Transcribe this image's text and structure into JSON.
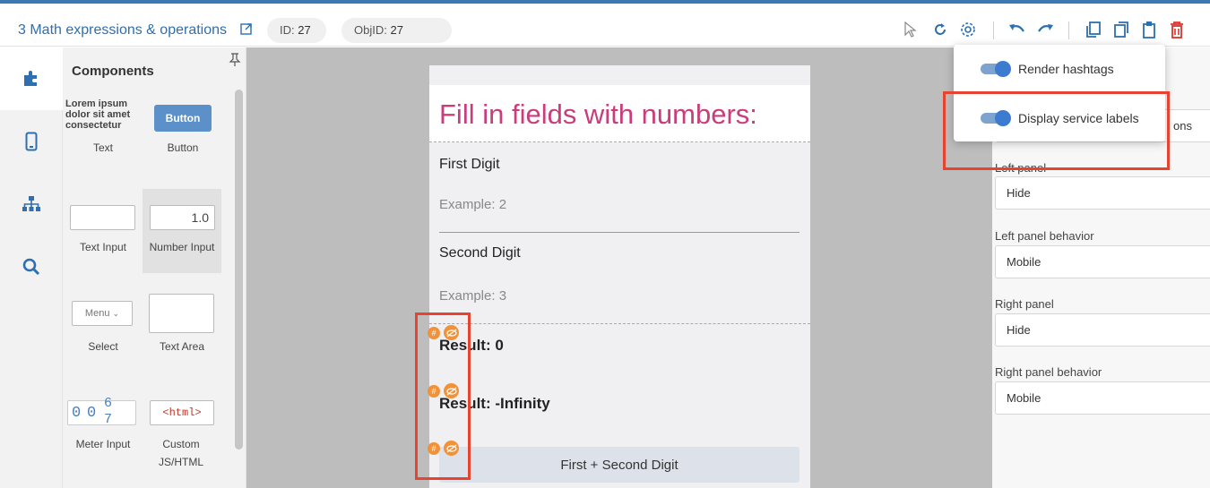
{
  "header": {
    "title": "3 Math expressions & operations",
    "id_label": "ID:",
    "id_value": "27",
    "objid_label": "ObjID:",
    "objid_value": "27"
  },
  "components": {
    "title": "Components",
    "lorem": "Lorem ipsum dolor sit amet consectetur",
    "button_preview": "Button",
    "number_preview": "1.0",
    "menu_preview": "Menu",
    "meter_digits": [
      "0",
      "0",
      "6",
      "7"
    ],
    "html_preview": "<html>",
    "items": [
      "Text",
      "Button",
      "Text Input",
      "Number Input",
      "Select",
      "Text Area",
      "Meter Input",
      "Custom JS/HTML"
    ]
  },
  "screen": {
    "heading": "Fill in fields with numbers:",
    "first_label": "First Digit",
    "first_placeholder": "Example: 2",
    "second_label": "Second Digit",
    "second_placeholder": "Example: 3",
    "result1": "Result: 0",
    "result2": "Result: -Infinity",
    "sum_button": "First + Second Digit",
    "hash_badge": "#"
  },
  "popup": {
    "render_hashtags": "Render hashtags",
    "display_service_labels": "Display service labels"
  },
  "right_panel": {
    "partial_text": "ons",
    "left_panel_label": "Left panel",
    "left_panel_value": "Hide",
    "left_panel_behavior_label": "Left panel behavior",
    "left_panel_behavior_value": "Mobile",
    "right_panel_label": "Right panel",
    "right_panel_value": "Hide",
    "right_panel_behavior_label": "Right panel behavior",
    "right_panel_behavior_value": "Mobile"
  },
  "colors": {
    "accent": "#2d6fb1",
    "heading": "#c83d7b",
    "highlight": "#e8432f",
    "badge": "#f0923a",
    "delete": "#d9342b"
  }
}
